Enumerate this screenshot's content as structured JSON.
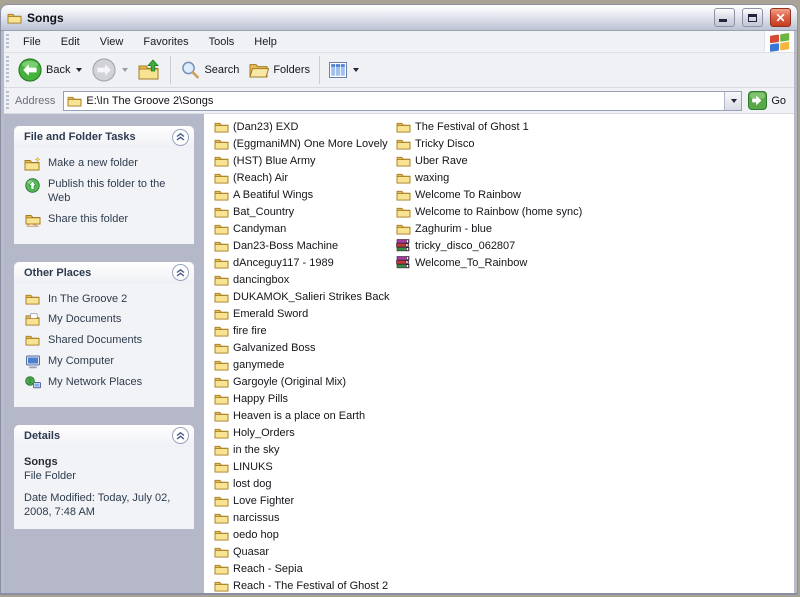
{
  "window": {
    "title": "Songs"
  },
  "menu": {
    "items": [
      "File",
      "Edit",
      "View",
      "Favorites",
      "Tools",
      "Help"
    ]
  },
  "toolbar": {
    "back_label": "Back",
    "search_label": "Search",
    "folders_label": "Folders"
  },
  "address": {
    "label": "Address",
    "value": "E:\\In The Groove 2\\Songs",
    "go_label": "Go"
  },
  "sidebar": {
    "tasks": {
      "title": "File and Folder Tasks",
      "items": [
        {
          "icon": "new-folder-icon",
          "label": "Make a new folder"
        },
        {
          "icon": "publish-web-icon",
          "label": "Publish this folder to the Web"
        },
        {
          "icon": "share-folder-icon",
          "label": "Share this folder"
        }
      ]
    },
    "places": {
      "title": "Other Places",
      "items": [
        {
          "icon": "folder-icon",
          "label": "In The Groove 2"
        },
        {
          "icon": "my-documents-icon",
          "label": "My Documents"
        },
        {
          "icon": "folder-icon",
          "label": "Shared Documents"
        },
        {
          "icon": "my-computer-icon",
          "label": "My Computer"
        },
        {
          "icon": "network-places-icon",
          "label": "My Network Places"
        }
      ]
    },
    "details": {
      "title": "Details",
      "name": "Songs",
      "type": "File Folder",
      "modified": "Date Modified: Today, July 02, 2008, 7:48 AM"
    }
  },
  "files": {
    "column1": [
      {
        "icon": "folder-icon",
        "label": "(Dan23) EXD"
      },
      {
        "icon": "folder-icon",
        "label": "(EggmaniMN) One More Lovely"
      },
      {
        "icon": "folder-icon",
        "label": "(HST) Blue Army"
      },
      {
        "icon": "folder-icon",
        "label": "(Reach) Air"
      },
      {
        "icon": "folder-icon",
        "label": "A Beatiful Wings"
      },
      {
        "icon": "folder-icon",
        "label": "Bat_Country"
      },
      {
        "icon": "folder-icon",
        "label": "Candyman"
      },
      {
        "icon": "folder-icon",
        "label": "Dan23-Boss Machine"
      },
      {
        "icon": "folder-icon",
        "label": "dAnceguy117 - 1989"
      },
      {
        "icon": "folder-icon",
        "label": "dancingbox"
      },
      {
        "icon": "folder-icon",
        "label": "DUKAMOK_Salieri Strikes Back"
      },
      {
        "icon": "folder-icon",
        "label": "Emerald Sword"
      },
      {
        "icon": "folder-icon",
        "label": "fire fire"
      },
      {
        "icon": "folder-icon",
        "label": "Galvanized Boss"
      },
      {
        "icon": "folder-icon",
        "label": "ganymede"
      },
      {
        "icon": "folder-icon",
        "label": "Gargoyle (Original Mix)"
      },
      {
        "icon": "folder-icon",
        "label": "Happy Pills"
      },
      {
        "icon": "folder-icon",
        "label": "Heaven is a place on Earth"
      },
      {
        "icon": "folder-icon",
        "label": "Holy_Orders"
      },
      {
        "icon": "folder-icon",
        "label": "in the sky"
      },
      {
        "icon": "folder-icon",
        "label": "LINUKS"
      },
      {
        "icon": "folder-icon",
        "label": "lost dog"
      },
      {
        "icon": "folder-icon",
        "label": "Love Fighter"
      },
      {
        "icon": "folder-icon",
        "label": "narcissus"
      },
      {
        "icon": "folder-icon",
        "label": "oedo hop"
      },
      {
        "icon": "folder-icon",
        "label": "Quasar"
      },
      {
        "icon": "folder-icon",
        "label": "Reach - Sepia"
      },
      {
        "icon": "folder-icon",
        "label": "Reach - The Festival of Ghost 2"
      }
    ],
    "column2": [
      {
        "icon": "folder-icon",
        "label": "The Festival of Ghost 1"
      },
      {
        "icon": "folder-icon",
        "label": "Tricky Disco"
      },
      {
        "icon": "folder-icon",
        "label": "Uber Rave"
      },
      {
        "icon": "folder-icon",
        "label": "waxing"
      },
      {
        "icon": "folder-icon",
        "label": "Welcome To Rainbow"
      },
      {
        "icon": "folder-icon",
        "label": "Welcome to Rainbow (home sync)"
      },
      {
        "icon": "folder-icon",
        "label": "Zaghurim - blue"
      },
      {
        "icon": "archive-icon",
        "label": "tricky_disco_062807"
      },
      {
        "icon": "archive-icon",
        "label": "Welcome_To_Rainbow"
      }
    ]
  }
}
